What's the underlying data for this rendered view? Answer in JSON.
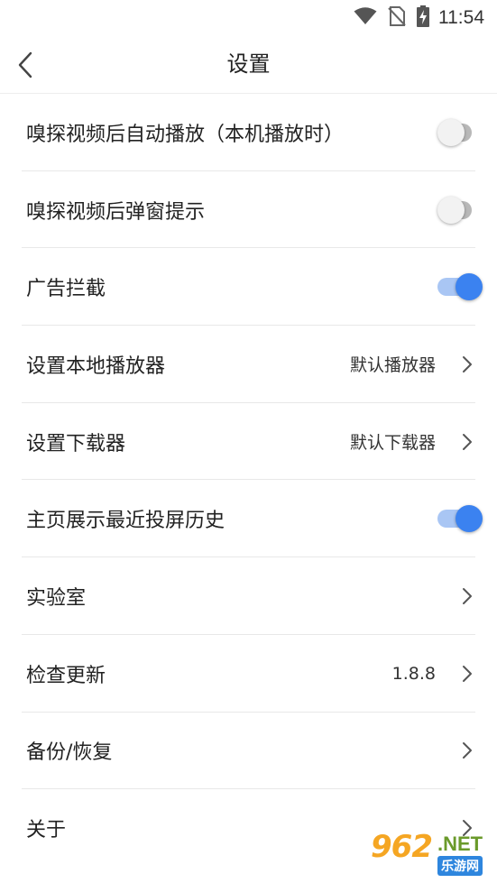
{
  "status_bar": {
    "time": "11:54",
    "icons": [
      "wifi-icon",
      "no-sim-icon",
      "battery-charging-icon"
    ]
  },
  "header": {
    "title": "设置",
    "back_icon": "chevron-left-icon"
  },
  "settings": [
    {
      "label": "嗅探视频后自动播放（本机播放时）",
      "type": "toggle",
      "on": false
    },
    {
      "label": "嗅探视频后弹窗提示",
      "type": "toggle",
      "on": false
    },
    {
      "label": "广告拦截",
      "type": "toggle",
      "on": true
    },
    {
      "label": "设置本地播放器",
      "type": "link",
      "value": "默认播放器"
    },
    {
      "label": "设置下载器",
      "type": "link",
      "value": "默认下载器"
    },
    {
      "label": "主页展示最近投屏历史",
      "type": "toggle",
      "on": true
    },
    {
      "label": "实验室",
      "type": "link"
    },
    {
      "label": "检查更新",
      "type": "link",
      "value": "1.8.8"
    },
    {
      "label": "备份/恢复",
      "type": "link"
    },
    {
      "label": "关于",
      "type": "link"
    }
  ],
  "colors": {
    "toggle_on_thumb": "#3b82f0",
    "toggle_on_track": "#a9c6f4",
    "toggle_off_track": "#b8b8b8",
    "divider": "#e8e8e8"
  },
  "watermark": {
    "number": "962",
    "suffix": ".NET",
    "caption": "乐游网"
  }
}
